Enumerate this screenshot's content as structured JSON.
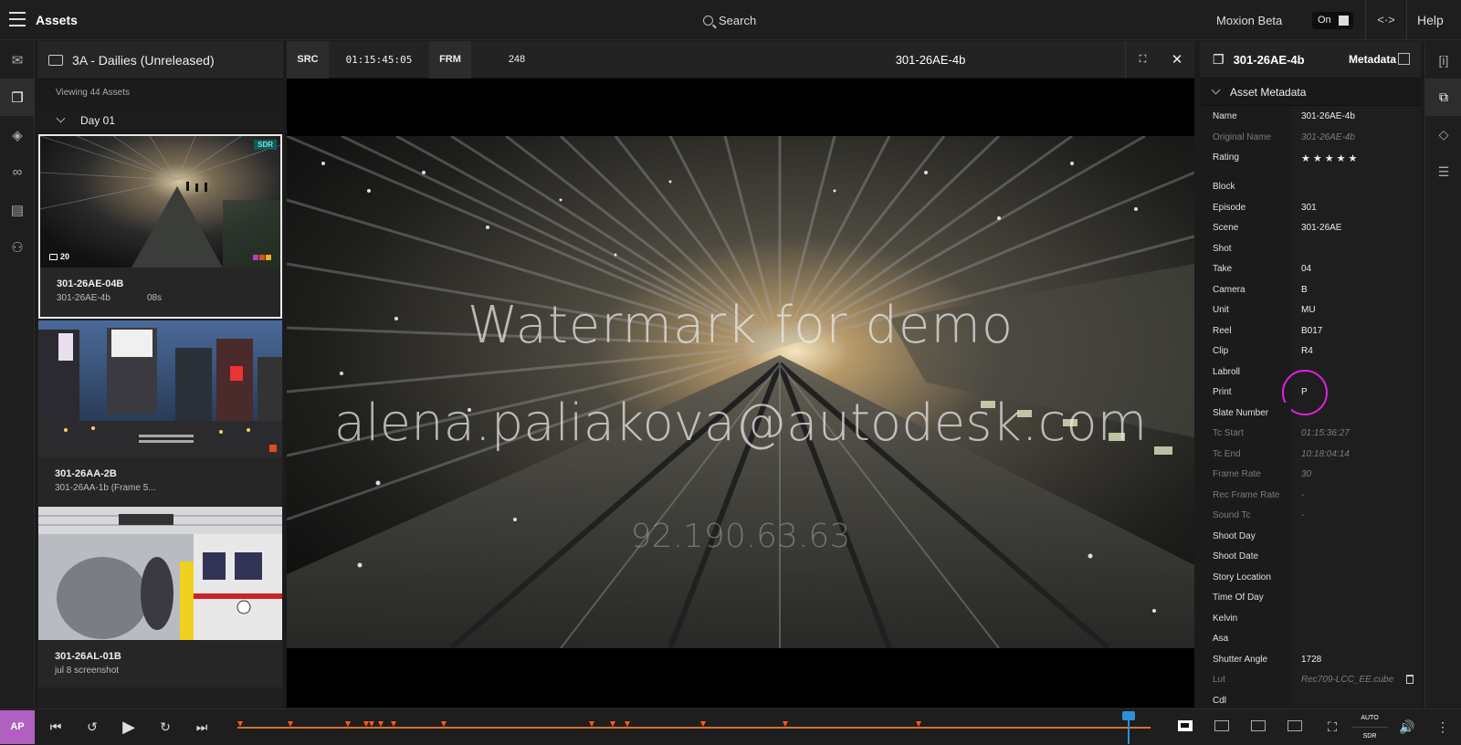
{
  "topbar": {
    "title": "Assets",
    "search_label": "Search",
    "beta_label": "Moxion Beta",
    "toggle_label": "On",
    "code_label": "<·>",
    "help_label": "Help"
  },
  "left_rail": [
    "inbox-icon",
    "assets-icon",
    "layers-icon",
    "link-icon",
    "storyboard-icon",
    "people-icon"
  ],
  "assets_panel": {
    "folder": "3A - Dailies (Unreleased)",
    "viewing": "Viewing 44 Assets",
    "day": "Day 01",
    "cards": [
      {
        "title": "301-26AE-04B",
        "subtitle": "301-26AE-4b",
        "duration": "08s",
        "badge": "SDR",
        "comments": "20"
      },
      {
        "title": "301-26AA-2B",
        "subtitle": "301-26AA-1b (Frame 5...",
        "duration": ""
      },
      {
        "title": "301-26AL-01B",
        "subtitle": "jul 8 screenshot",
        "duration": ""
      }
    ]
  },
  "viewer": {
    "src_label": "SRC",
    "timecode": "01:15:45:05",
    "frm_label": "FRM",
    "frame": "248",
    "clip": "301-26AE-4b",
    "watermark_line1": "Watermark for demo",
    "watermark_line2": "alena.paliakova@autodesk.com",
    "watermark_ip": "92.190.63.63"
  },
  "metadata": {
    "clip": "301-26AE-4b",
    "tab": "Metadata",
    "section": "Asset Metadata",
    "rows": [
      {
        "key": "Name",
        "value": "301-26AE-4b"
      },
      {
        "key": "Original Name",
        "value": "301-26AE-4b",
        "dim": true
      },
      {
        "key": "Rating",
        "value": "★★★★★"
      },
      {
        "key": "Block",
        "value": ""
      },
      {
        "key": "Episode",
        "value": "301"
      },
      {
        "key": "Scene",
        "value": "301-26AE"
      },
      {
        "key": "Shot",
        "value": ""
      },
      {
        "key": "Take",
        "value": "04"
      },
      {
        "key": "Camera",
        "value": "B"
      },
      {
        "key": "Unit",
        "value": "MU"
      },
      {
        "key": "Reel",
        "value": "B017"
      },
      {
        "key": "Clip",
        "value": "R4"
      },
      {
        "key": "Labroll",
        "value": ""
      },
      {
        "key": "Print",
        "value": "P"
      },
      {
        "key": "Slate Number",
        "value": ""
      },
      {
        "key": "Tc Start",
        "value": "01:15:36:27",
        "dim": true
      },
      {
        "key": "Tc End",
        "value": "10:18:04:14",
        "dim": true
      },
      {
        "key": "Frame Rate",
        "value": "30",
        "dim": true
      },
      {
        "key": "Rec Frame Rate",
        "value": "-",
        "dim": true
      },
      {
        "key": "Sound Tc",
        "value": "-",
        "dim": true
      },
      {
        "key": "Shoot Day",
        "value": ""
      },
      {
        "key": "Shoot Date",
        "value": ""
      },
      {
        "key": "Story Location",
        "value": ""
      },
      {
        "key": "Time Of Day",
        "value": ""
      },
      {
        "key": "Kelvin",
        "value": ""
      },
      {
        "key": "Asa",
        "value": ""
      },
      {
        "key": "Shutter Angle",
        "value": "1728"
      },
      {
        "key": "Lut",
        "value": "Rec709-LCC_EE.cube",
        "dim": true
      },
      {
        "key": "Cdl",
        "value": ""
      }
    ]
  },
  "right_rail": [
    "info-icon",
    "related-icon",
    "tag-icon",
    "comment-icon"
  ],
  "transport": {
    "avatar": "AP",
    "auto_label": "AUTO",
    "sdr_label": "SDR",
    "progress": 0.975
  }
}
